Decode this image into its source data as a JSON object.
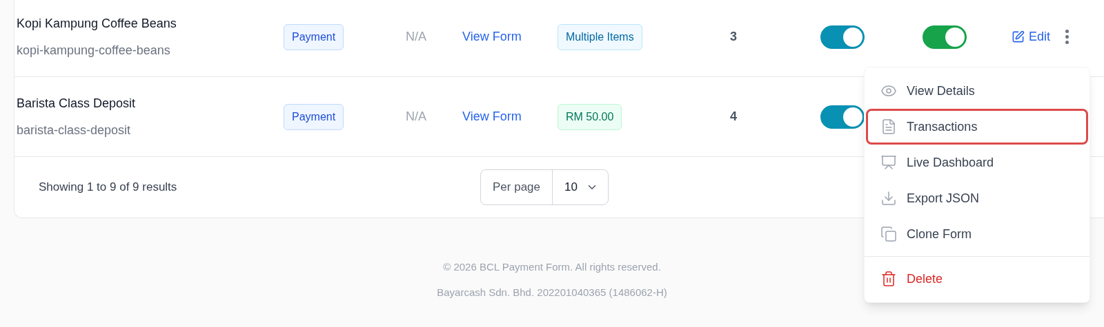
{
  "rows": [
    {
      "name": "Kopi Kampung Coffee Beans",
      "slug": "kopi-kampung-coffee-beans",
      "type": "Payment",
      "col_3": "N/A",
      "link": "View Form",
      "amount": {
        "text": "Multiple Items",
        "kind": "items"
      },
      "count": "3",
      "toggles": [
        {
          "on": true,
          "color": "#0891b2"
        },
        {
          "on": true,
          "color": "#16a34a"
        }
      ],
      "edit": "Edit"
    },
    {
      "name": "Barista Class Deposit",
      "slug": "barista-class-deposit",
      "type": "Payment",
      "col_3": "N/A",
      "link": "View Form",
      "amount": {
        "text": "RM 50.00",
        "kind": "price"
      },
      "count": "4",
      "toggles": [
        {
          "on": true,
          "color": "#0891b2"
        }
      ]
    }
  ],
  "pagination": {
    "summary": "Showing 1 to 9 of 9 results",
    "per_page_label": "Per page",
    "per_page_value": "10"
  },
  "menu": [
    {
      "label": "View Details",
      "kind": "item",
      "highlighted": false
    },
    {
      "label": "Transactions",
      "kind": "item",
      "highlighted": true
    },
    {
      "label": "Live Dashboard",
      "kind": "item",
      "highlighted": false
    },
    {
      "label": "Export JSON",
      "kind": "item",
      "highlighted": false
    },
    {
      "label": "Clone Form",
      "kind": "item",
      "highlighted": false
    },
    {
      "label": "Delete",
      "kind": "danger",
      "highlighted": false
    }
  ],
  "footer": [
    "© 2026 BCL Payment Form. All rights reserved.",
    "Bayarcash Sdn. Bhd. 202201040365 (1486062-H)"
  ]
}
